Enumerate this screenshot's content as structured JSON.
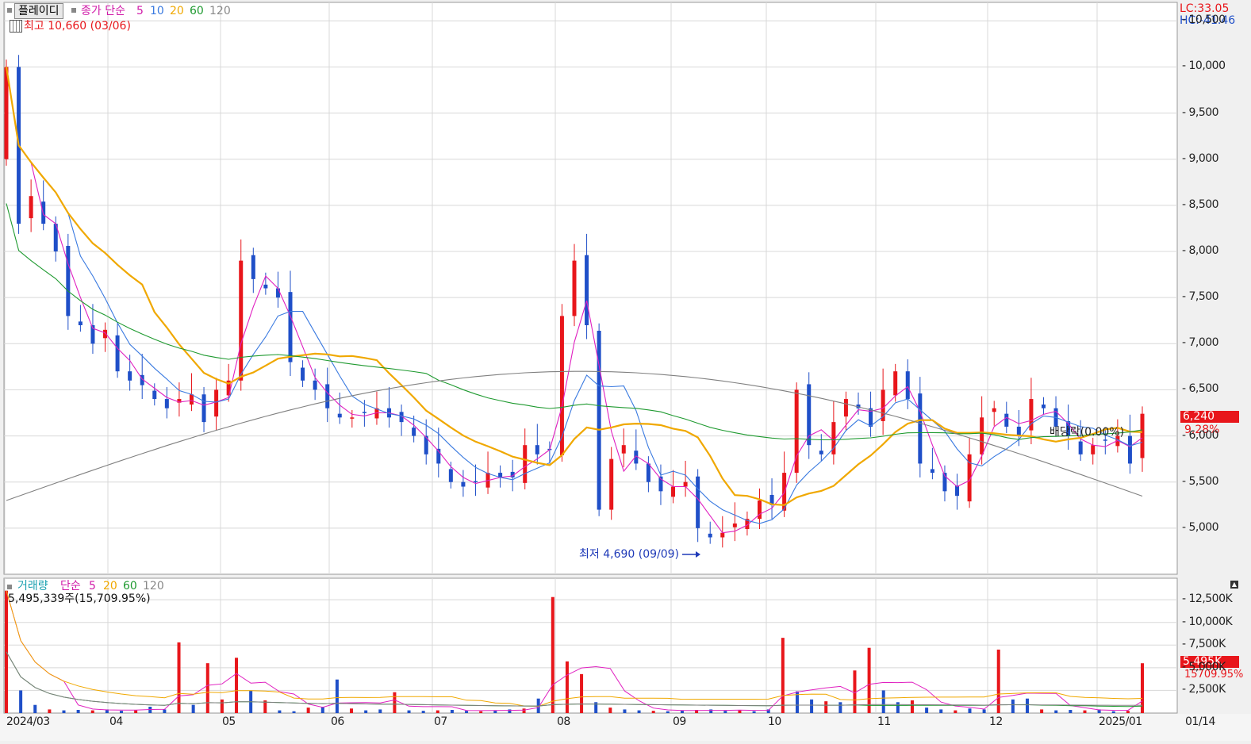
{
  "price_legend": {
    "button": "플레이디",
    "title": "종가 단순",
    "periods": [
      "5",
      "10",
      "20",
      "60",
      "120"
    ],
    "ma_colors": [
      "#e020c0",
      "#3a7ae0",
      "#f0a800",
      "#1f9a30",
      "#808080"
    ]
  },
  "price_high_label": "최고 10,660 (03/06)",
  "price_low_label": "최저 4,690 (09/09)",
  "lc_label": "LC:33.05",
  "hc_label": "HC:-41.46",
  "current_price_tag": "6,240",
  "current_change_tag": "9.28%",
  "dividend_label": "배당락(0.00%)",
  "volume_legend": {
    "title": "거래량",
    "ma_title": "단순",
    "periods": [
      "5",
      "20",
      "60",
      "120"
    ]
  },
  "volume_value_label": "5,495,339주(15,709.95%)",
  "current_volume_tag": "5,495K",
  "current_volume_pct": "15709.95%",
  "colors": {
    "up": "#e8161b",
    "down": "#1f4fc8",
    "grid": "#d8d8d8"
  },
  "chart_data": [
    {
      "type": "candlestick",
      "title": "",
      "x_labels": [
        "2024/03",
        "04",
        "05",
        "06",
        "07",
        "08",
        "09",
        "10",
        "11",
        "12",
        "2025/01",
        "01/14"
      ],
      "y_ticks": [
        "5,000",
        "5,500",
        "6,000",
        "6,500",
        "7,000",
        "7,500",
        "8,000",
        "8,500",
        "9,000",
        "9,500",
        "10,000",
        "10,500"
      ],
      "ylim": [
        4500,
        10700
      ],
      "close": [
        10000,
        8300,
        8600,
        8300,
        8000,
        7300,
        7200,
        7000,
        7150,
        6700,
        6600,
        6550,
        6400,
        6300,
        6400,
        6450,
        6150,
        6500,
        6600,
        7900,
        7700,
        7600,
        7500,
        6800,
        6600,
        6500,
        6300,
        6200,
        6200,
        6250,
        6300,
        6200,
        6150,
        6000,
        5800,
        5700,
        5500,
        5450,
        5500,
        5600,
        5550,
        5550,
        5900,
        5800,
        5850,
        7300,
        7900,
        7200,
        5200,
        5750,
        5900,
        5700,
        5500,
        5400,
        5450,
        5500,
        5000,
        4900,
        4950,
        5050,
        5100,
        5300,
        5250,
        5600,
        6500,
        5900,
        5800,
        6150,
        6400,
        6300,
        6100,
        6500,
        6700,
        6400,
        5700,
        5600,
        5400,
        5350,
        5800,
        6200,
        6300,
        6100,
        6000,
        6400,
        6300,
        6100,
        6000,
        5800,
        5900,
        5950,
        6000,
        5700,
        6240
      ],
      "volume_unit": "K",
      "volume": [
        13500,
        2500,
        900,
        400,
        300,
        350,
        300,
        400,
        250,
        300,
        700,
        400,
        7800,
        900,
        5500,
        1500,
        6100,
        2500,
        1400,
        300,
        200,
        600,
        700,
        3700,
        500,
        300,
        400,
        2300,
        300,
        250,
        300,
        350,
        250,
        200,
        300,
        400,
        500,
        1600,
        12800,
        5700,
        4300,
        1200,
        600,
        400,
        300,
        250,
        200,
        300,
        350,
        400,
        250,
        300,
        200,
        400,
        8300,
        2400,
        1500,
        1300,
        1200,
        4700,
        7200,
        2500,
        1200,
        1400,
        600,
        400,
        300,
        500,
        400,
        7000,
        1500,
        1600,
        400,
        300,
        350,
        300,
        400,
        200,
        250,
        5495
      ],
      "volume_ticks": [
        "2,500K",
        "5,000K",
        "7,500K",
        "10,000K",
        "12,500K"
      ]
    }
  ]
}
